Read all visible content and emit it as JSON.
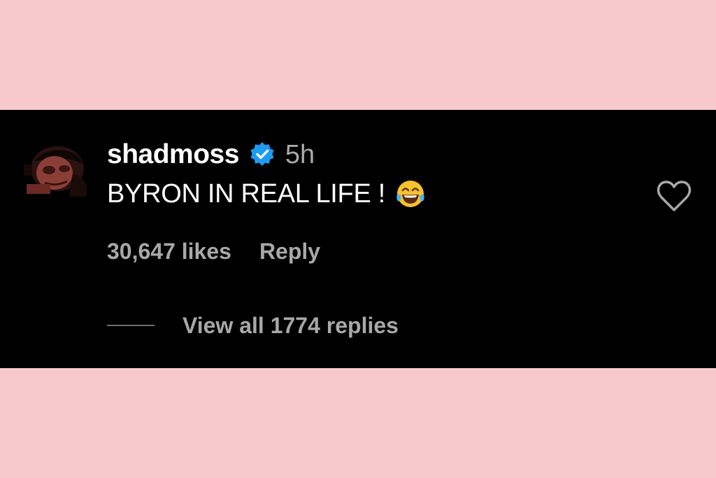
{
  "comment": {
    "username": "shadmoss",
    "verified": true,
    "timestamp": "5h",
    "text": "BYRON IN REAL LIFE !",
    "emoji_icon": "face-with-tears-of-joy-icon",
    "likes_label": "30,647 likes",
    "reply_label": "Reply",
    "view_replies_label": "View all 1774 replies",
    "like_icon": "heart-outline-icon",
    "avatar_icon": "profile-photo"
  },
  "colors": {
    "page_background": "#f8c9cc",
    "card_background": "#000000",
    "primary_text": "#ffffff",
    "secondary_text": "#a8a8a8",
    "verified_badge": "#1d9bf0"
  }
}
